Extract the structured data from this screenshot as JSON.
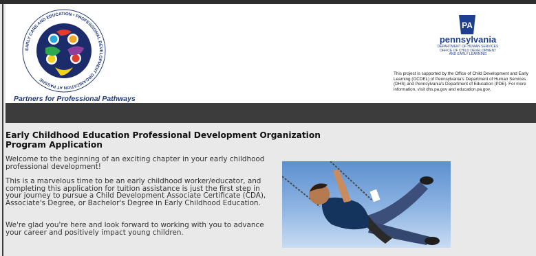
{
  "header": {
    "logo": {
      "ring_text": "EARLY CARE AND EDUCATION • PROFESSIONAL DEVELOPMENT ORGANIZATION AT PASSHE",
      "tagline": "Partners for Professional Pathways"
    },
    "pa": {
      "badge": "PA",
      "name": "pennsylvania",
      "dept_lines": [
        "DEPARTMENT OF HUMAN SERVICES",
        "OFFICE OF CHILD DEVELOPMENT",
        "AND EARLY LEARNING"
      ],
      "note": "This project is supported by the Office of Child Development and Early Learning (OCDEL) of Pennsylvania's Department of Human Services (DHS) and Pennsylvania's Department of Education (PDE). For more information, visit dhs.pa.gov and education.pa.gov."
    }
  },
  "main": {
    "title": "Early Childhood Education Professional Development Organization Program Application",
    "paragraphs": [
      "Welcome to the beginning of an exciting chapter in your early childhood professional development!",
      "This is a marvelous time to be an early childhood worker/educator, and completing this application for tuition assistance is just the first step in your journey to pursue a Child Development Associate Certificate (CDA), Associate's Degree, or Bachelor's Degree in Early Childhood Education.",
      "We're glad you're here and look forward to working with you to advance your career and positively impact young children."
    ]
  },
  "colors": {
    "navbar": "#3c3c3c",
    "background": "#e9e9e9",
    "pa_blue": "#1d3f8f",
    "logo_navy": "#233b7a"
  }
}
